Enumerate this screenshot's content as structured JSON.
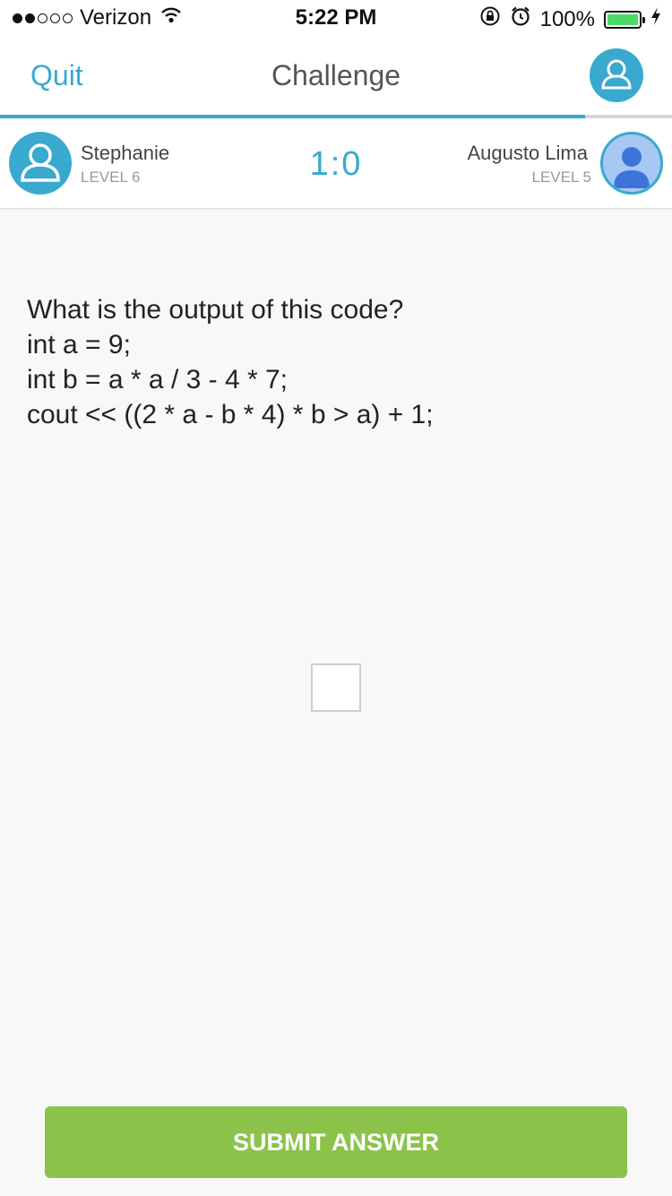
{
  "status_bar": {
    "carrier": "Verizon",
    "time": "5:22 PM",
    "battery": "100%",
    "signal_filled": 2,
    "signal_total": 5
  },
  "nav": {
    "quit_label": "Quit",
    "title": "Challenge",
    "progress": 0.87
  },
  "players": {
    "left": {
      "name": "Stephanie",
      "level": "LEVEL 6"
    },
    "score": "1:0",
    "right": {
      "name": "Augusto Lima",
      "level": "LEVEL 5"
    }
  },
  "question": {
    "lines": [
      "What is the output of this code?",
      "int a = 9;",
      "int b = a * a / 3 - 4 * 7;",
      "cout << ((2 * a - b * 4) * b > a) + 1;"
    ]
  },
  "answer": {
    "value": ""
  },
  "submit_label": "SUBMIT ANSWER",
  "colors": {
    "accent": "#3aa9cf",
    "submit": "#8bc34a",
    "battery": "#4cd964"
  }
}
